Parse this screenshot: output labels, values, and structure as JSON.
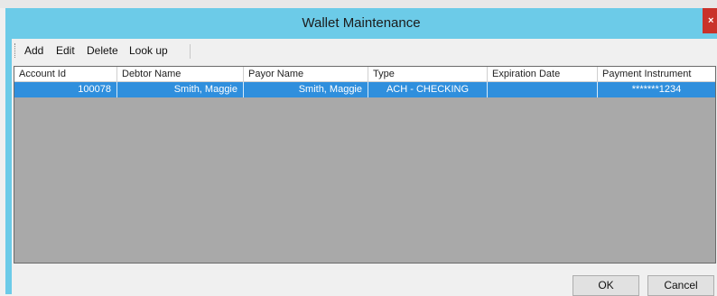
{
  "window": {
    "title": "Wallet Maintenance",
    "close_glyph": "×"
  },
  "toolbar": {
    "add": "Add",
    "edit": "Edit",
    "delete": "Delete",
    "lookup": "Look up"
  },
  "grid": {
    "columns": [
      "Account Id",
      "Debtor Name",
      "Payor Name",
      "Type",
      "Expiration Date",
      "Payment Instrument"
    ],
    "rows": [
      {
        "account_id": "100078",
        "debtor_name": "Smith, Maggie",
        "payor_name": "Smith, Maggie",
        "type": "ACH - CHECKING",
        "expiration_date": "",
        "payment_instrument": "*******1234"
      }
    ]
  },
  "buttons": {
    "ok": "OK",
    "cancel": "Cancel"
  },
  "colors": {
    "titlebar": "#6ccbe8",
    "selection": "#2f8fdd",
    "grid_background": "#a9a9a9"
  }
}
